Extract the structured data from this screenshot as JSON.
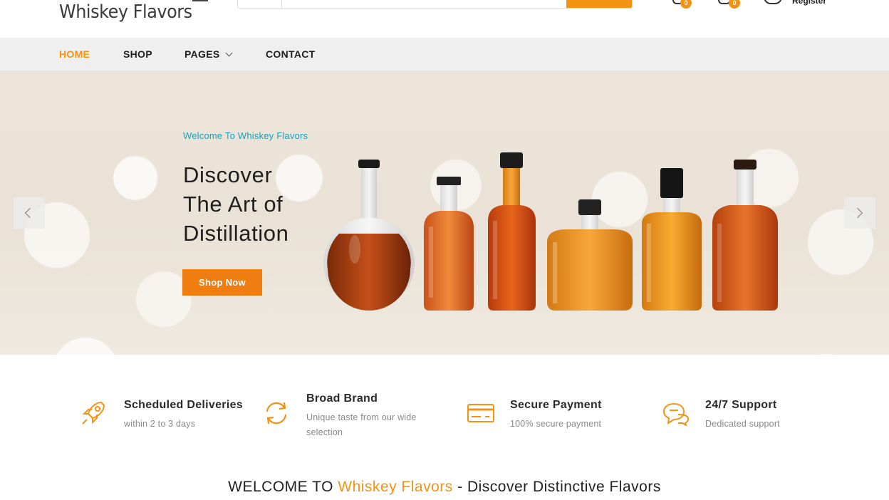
{
  "header": {
    "logo": "Whiskey Flavors",
    "search_placeholder": "",
    "wishlist_count": "0",
    "cart_count": "0",
    "register_label": "Register"
  },
  "nav": {
    "items": [
      {
        "label": "HOME"
      },
      {
        "label": "SHOP"
      },
      {
        "label": "PAGES"
      },
      {
        "label": "CONTACT"
      }
    ]
  },
  "hero": {
    "kicker": "Welcome To Whiskey Flavors",
    "title_lines": [
      "Discover",
      "The Art of",
      "Distillation"
    ],
    "cta_label": "Shop Now"
  },
  "features": [
    {
      "title": "Scheduled Deliveries",
      "subtitle": "within 2 to 3 days",
      "icon": "rocket-icon"
    },
    {
      "title": "Broad Brand",
      "subtitle_lines": [
        "Unique taste from our wide",
        "selection"
      ],
      "icon": "refresh-icon"
    },
    {
      "title": "Secure Payment",
      "subtitle": "100% secure payment",
      "icon": "credit-card-icon"
    },
    {
      "title": "24/7 Support",
      "subtitle": "Dedicated support",
      "icon": "chat-bubbles-icon"
    }
  ],
  "welcome": {
    "prefix": "WELCOME TO ",
    "brand": "Whiskey Flavors",
    "suffix": " - Discover Distinctive Flavors"
  },
  "colors": {
    "accent": "#f39313",
    "cta": "#f07d10",
    "kicker": "#1aa0b8",
    "nav_bg": "#efefef"
  }
}
